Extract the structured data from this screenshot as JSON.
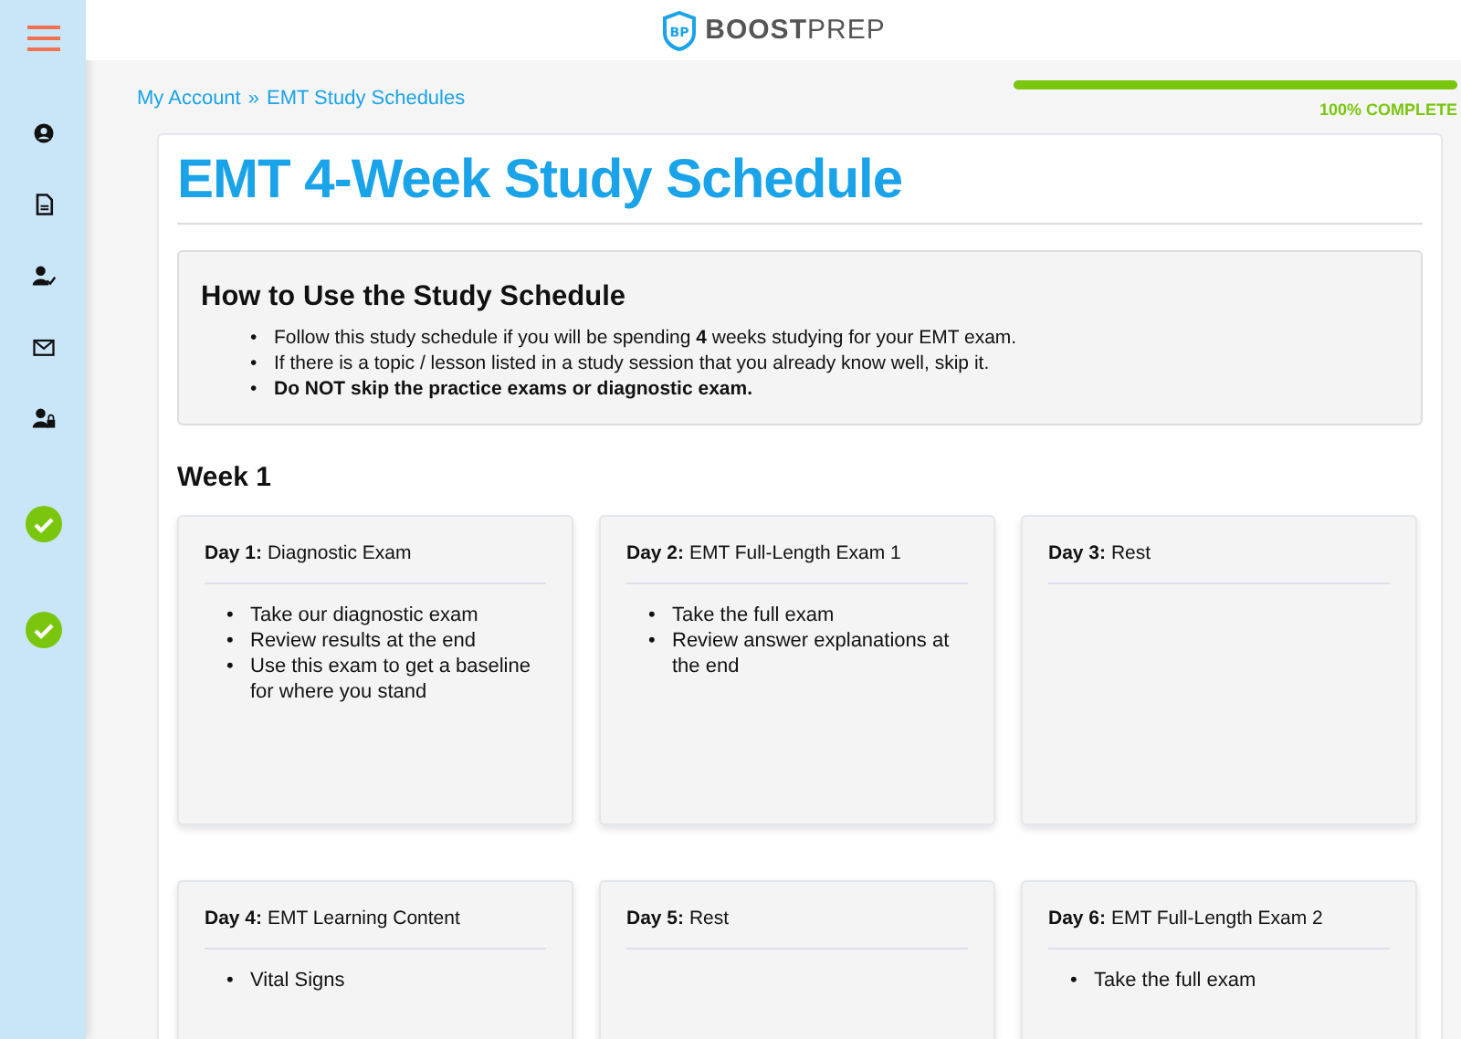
{
  "header": {
    "logo_bold": "BOOST",
    "logo_light": "PREP",
    "logo_mark": "BP"
  },
  "breadcrumb": [
    {
      "label": "My Account"
    },
    {
      "label": "EMT Study Schedules"
    }
  ],
  "breadcrumb_separator": "»",
  "progress": {
    "level": 1,
    "label": "100% COMPLETE"
  },
  "title": "EMT 4-Week Study Schedule",
  "bullet": "•",
  "instructions": {
    "heading": "How to Use the Study Schedule",
    "items": [
      "Follow this study schedule if you will be spending **4** weeks studying for your EMT exam.",
      "If there is a topic / lesson listed in a study session that you already know well, skip it.",
      "**Do NOT skip the practice exams or diagnostic exam.**"
    ]
  },
  "weeks": [
    {
      "heading": "Week 1",
      "days": [
        {
          "label": "Day 1:",
          "title": "Diagnostic Exam",
          "items": [
            "Take our diagnostic exam",
            "Review results at the end",
            "Use this exam to get a baseline for where you stand"
          ]
        },
        {
          "label": "Day 2:",
          "title": "EMT Full-Length Exam 1",
          "items": [
            "Take the full exam",
            "Review answer explanations at the end"
          ]
        },
        {
          "label": "Day 3:",
          "title": "Rest"
        },
        {
          "label": "Day 4:",
          "title": "EMT Learning Content",
          "items": [
            "Vital Signs"
          ]
        },
        {
          "label": "Day 5:",
          "title": "Rest"
        },
        {
          "label": "Day 6:",
          "title": "EMT Full-Length Exam 2",
          "items": [
            "Take the full exam"
          ]
        }
      ]
    }
  ]
}
